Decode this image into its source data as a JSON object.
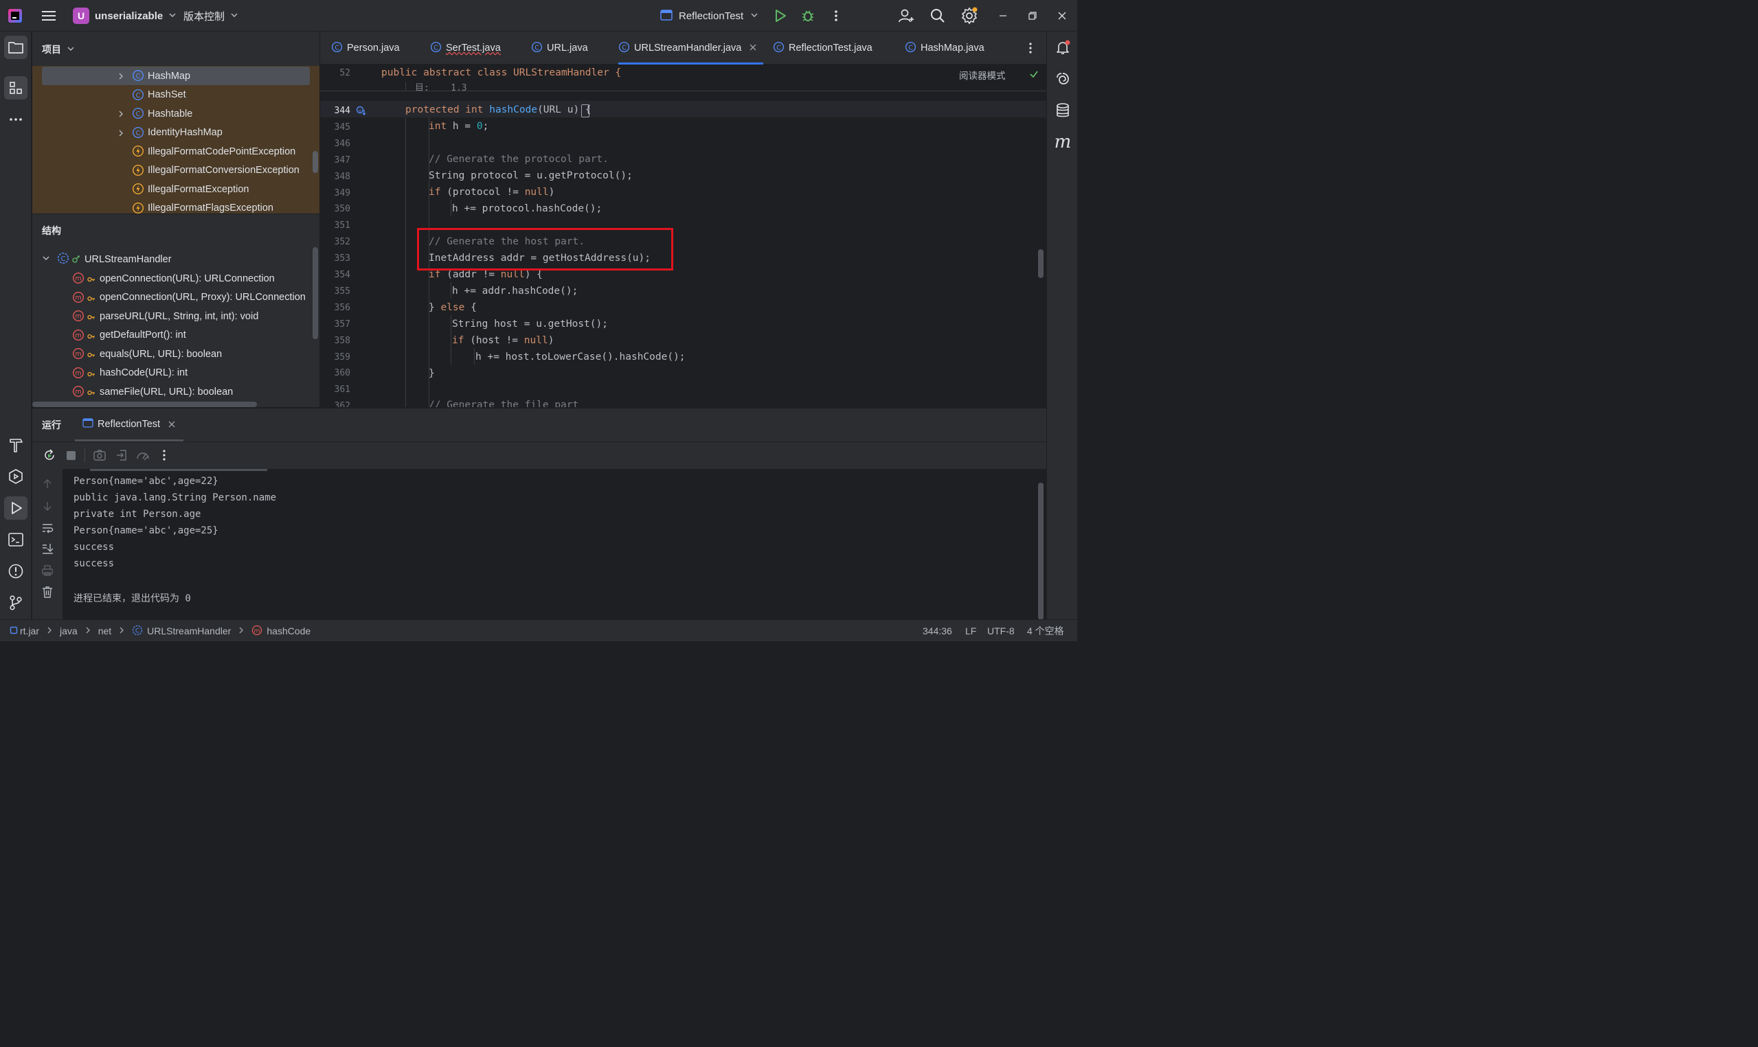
{
  "titlebar": {
    "project_badge": "U",
    "project_name": "unserializable",
    "vcs_label": "版本控制",
    "run_config": "ReflectionTest"
  },
  "project_panel": {
    "title": "项目",
    "items": [
      {
        "label": "HashMap",
        "kind": "class",
        "expandable": true
      },
      {
        "label": "HashSet",
        "kind": "class",
        "expandable": false
      },
      {
        "label": "Hashtable",
        "kind": "class",
        "expandable": true
      },
      {
        "label": "IdentityHashMap",
        "kind": "class",
        "expandable": true
      },
      {
        "label": "IllegalFormatCodePointException",
        "kind": "exception",
        "expandable": false
      },
      {
        "label": "IllegalFormatConversionException",
        "kind": "exception",
        "expandable": false
      },
      {
        "label": "IllegalFormatException",
        "kind": "exception",
        "expandable": false
      },
      {
        "label": "IllegalFormatFlagsException",
        "kind": "exception",
        "expandable": false
      }
    ]
  },
  "structure_panel": {
    "title": "结构",
    "root": "URLStreamHandler",
    "members": [
      "openConnection(URL): URLConnection",
      "openConnection(URL, Proxy): URLConnection",
      "parseURL(URL, String, int, int): void",
      "getDefaultPort(): int",
      "equals(URL, URL): boolean",
      "hashCode(URL): int",
      "sameFile(URL, URL): boolean"
    ]
  },
  "editor": {
    "tabs": [
      {
        "label": "Person.java",
        "active": false
      },
      {
        "label": "SerTest.java",
        "active": false
      },
      {
        "label": "URL.java",
        "active": false
      },
      {
        "label": "URLStreamHandler.java",
        "active": true
      },
      {
        "label": "ReflectionTest.java",
        "active": false
      },
      {
        "label": "HashMap.java",
        "active": false
      }
    ],
    "reader_mode": "阅读器模式",
    "sticky": {
      "num": "52",
      "text": "public abstract class URLStreamHandler {"
    },
    "sticky_fragment": "目:    1.3",
    "lines": [
      {
        "num": "344"
      },
      {
        "num": "345"
      },
      {
        "num": "346"
      },
      {
        "num": "347"
      },
      {
        "num": "348"
      },
      {
        "num": "349"
      },
      {
        "num": "350"
      },
      {
        "num": "351"
      },
      {
        "num": "352"
      },
      {
        "num": "353"
      },
      {
        "num": "354"
      },
      {
        "num": "355"
      },
      {
        "num": "356"
      },
      {
        "num": "357"
      },
      {
        "num": "358"
      },
      {
        "num": "359"
      },
      {
        "num": "360"
      },
      {
        "num": "361"
      },
      {
        "num": "362"
      }
    ],
    "code": {
      "l344_a": "protected int ",
      "l344_fn": "hashCode",
      "l344_b": "(URL u) {",
      "l345_kw": "int",
      "l345_a": " h = ",
      "l345_num": "0",
      "l345_b": ";",
      "l347": "// Generate the protocol part.",
      "l348": "String protocol = u.getProtocol();",
      "l349_kw": "if",
      "l349_a": " (protocol != ",
      "l349_null": "null",
      "l349_b": ")",
      "l350": "h += protocol.hashCode();",
      "l352": "// Generate the host part.",
      "l353": "InetAddress addr = getHostAddress(u);",
      "l354_kw": "if",
      "l354_a": " (addr != ",
      "l354_null": "null",
      "l354_b": ") {",
      "l355": "h += addr.hashCode();",
      "l356_a": "} ",
      "l356_kw": "else",
      "l356_b": " {",
      "l357": "String host = u.getHost();",
      "l358_kw": "if",
      "l358_a": " (host != ",
      "l358_null": "null",
      "l358_b": ")",
      "l359": "h += host.toLowerCase().hashCode();",
      "l360": "}",
      "l362": "// Generate the file part"
    }
  },
  "run_panel": {
    "title": "运行",
    "tab": "ReflectionTest",
    "output": [
      "Person{name='abc',age=22}",
      "public java.lang.String Person.name",
      "private int Person.age",
      "Person{name='abc',age=25}",
      "success",
      "success",
      "",
      "进程已结束，退出代码为 0"
    ]
  },
  "statusbar": {
    "crumbs": [
      "rt.jar",
      "java",
      "net",
      "URLStreamHandler",
      "hashCode"
    ],
    "position": "344:36",
    "line_sep": "LF",
    "encoding": "UTF-8",
    "indent": "4 个空格"
  },
  "colors": {
    "accent": "#3574f0",
    "highlight_box": "#e0141e",
    "run_green": "#5fb865"
  }
}
